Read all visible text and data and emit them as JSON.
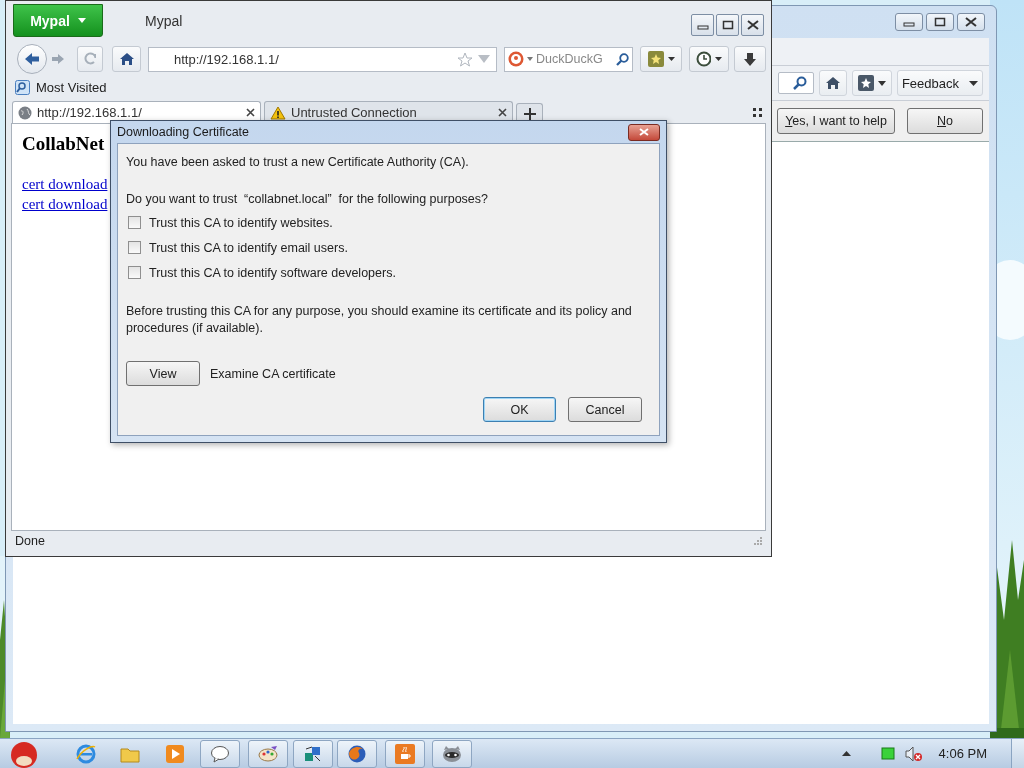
{
  "back_window": {
    "toolbar": {
      "feedback_button": "Feedback"
    },
    "notification_bar": {
      "buttons": [
        "Yes, I want to help",
        "No"
      ]
    }
  },
  "browser_window": {
    "app_button": "Mypal",
    "title": "Mypal",
    "address": {
      "value": "http://192.168.1.1/"
    },
    "search": {
      "placeholder": "DuckDuckG"
    },
    "bookmarks": [
      "Most Visited"
    ],
    "tabs": [
      {
        "label": "http://192.168.1.1/",
        "selected": true,
        "kind": "page"
      },
      {
        "label": "Untrusted Connection",
        "selected": false,
        "kind": "warning"
      }
    ],
    "page": {
      "heading": "CollabNet",
      "links": [
        "cert download",
        "cert download"
      ]
    },
    "status_bar": "Done"
  },
  "dialog": {
    "title": "Downloading Certificate",
    "intro": "You have been asked to trust a new Certificate Authority (CA).",
    "question": "Do you want to trust  “collabnet.local”  for the following purposes?",
    "options": [
      {
        "label": "Trust this CA to identify websites.",
        "checked": false
      },
      {
        "label": "Trust this CA to identify email users.",
        "checked": false
      },
      {
        "label": "Trust this CA to identify software developers.",
        "checked": false
      }
    ],
    "note": "Before trusting this CA for any purpose, you should examine its certificate and its policy and procedures (if available).",
    "view_button": "View",
    "view_label": "Examine CA certificate",
    "buttons": [
      "OK",
      "Cancel"
    ]
  },
  "taskbar": {
    "clock": "4:06 PM"
  }
}
